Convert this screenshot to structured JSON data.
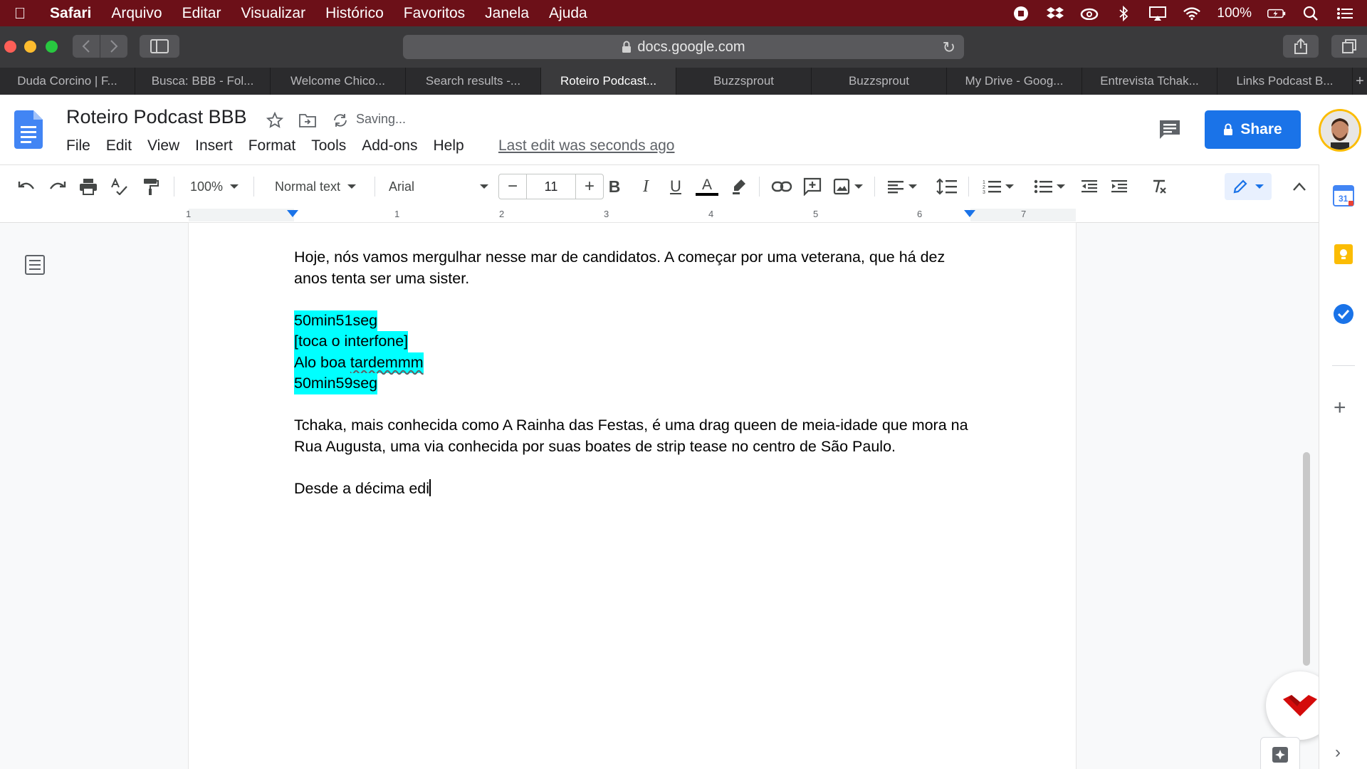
{
  "menubar": {
    "app_name": "Safari",
    "items": [
      "Arquivo",
      "Editar",
      "Visualizar",
      "Histórico",
      "Favoritos",
      "Janela",
      "Ajuda"
    ],
    "battery": "100%"
  },
  "browser": {
    "url": "docs.google.com",
    "tabs": [
      {
        "label": "Duda Corcino | F...",
        "active": false
      },
      {
        "label": "Busca: BBB - Fol...",
        "active": false
      },
      {
        "label": "Welcome Chico...",
        "active": false
      },
      {
        "label": "Search results -...",
        "active": false
      },
      {
        "label": "Roteiro Podcast...",
        "active": true
      },
      {
        "label": "Buzzsprout",
        "active": false
      },
      {
        "label": "Buzzsprout",
        "active": false
      },
      {
        "label": "My Drive - Goog...",
        "active": false
      },
      {
        "label": "Entrevista Tchak...",
        "active": false
      },
      {
        "label": "Links Podcast B...",
        "active": false
      }
    ]
  },
  "docs": {
    "title": "Roteiro Podcast BBB",
    "save_status": "Saving...",
    "menu": [
      "File",
      "Edit",
      "View",
      "Insert",
      "Format",
      "Tools",
      "Add-ons",
      "Help"
    ],
    "last_edit": "Last edit was seconds ago",
    "share_label": "Share",
    "brand_color": "#1a73e8"
  },
  "toolbar": {
    "zoom": "100%",
    "style": "Normal text",
    "font": "Arial",
    "font_size": "11"
  },
  "ruler": {
    "numbers": [
      "1",
      "1",
      "2",
      "3",
      "4",
      "5",
      "6",
      "7"
    ]
  },
  "document": {
    "para1": "Hoje, nós vamos mergulhar nesse mar de candidatos. A começar por uma veterana, que há dez anos tenta ser uma sister.",
    "highlight_color": "#00ffff",
    "highlight_lines": [
      "50min51seg",
      "[toca o interfone]",
      "Alo boa ",
      "tardemmm",
      "50min59seg"
    ],
    "para2": "Tchaka, mais conhecida como A Rainha das Festas, é uma drag queen de meia-idade que mora na Rua Augusta, uma via conhecida por suas boates de strip tease no centro de São Paulo.",
    "para3": "Desde a décima edi"
  }
}
